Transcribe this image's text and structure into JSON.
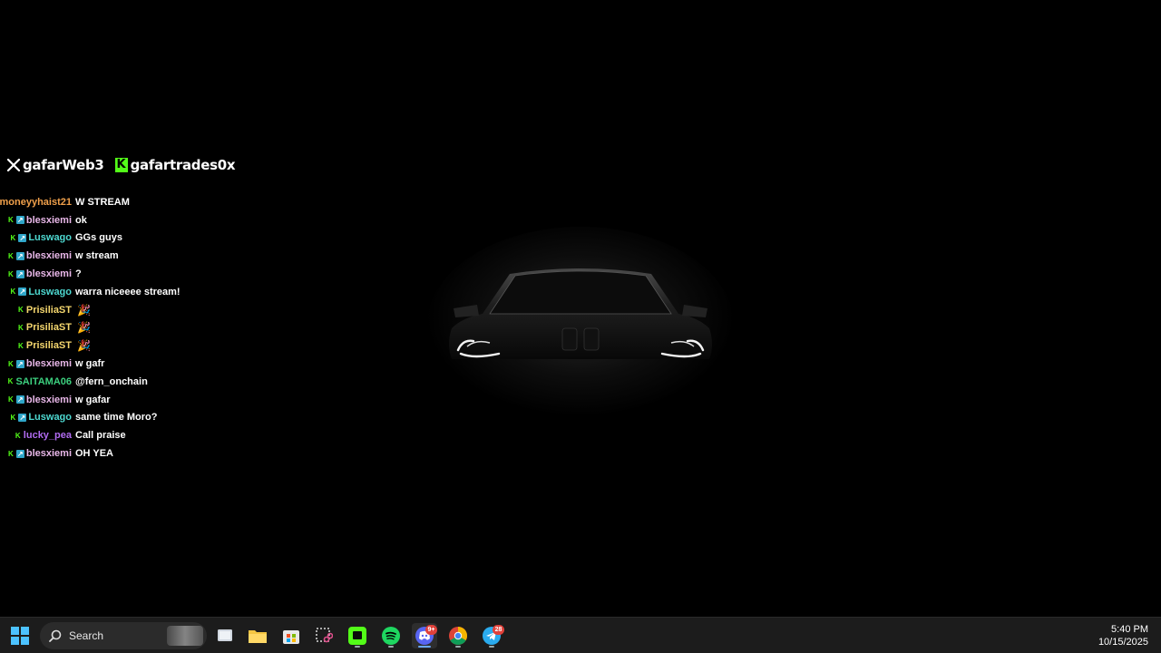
{
  "social": {
    "x_handle": "gafarWeb3",
    "kick_handle": "gafartrades0x"
  },
  "chat": [
    {
      "user": "moneyyhaist21",
      "color": "#f0a04b",
      "badges": [],
      "text": "W STREAM"
    },
    {
      "user": "blesxiemi",
      "color": "#e8b7e8",
      "badges": [
        "kick",
        "sub"
      ],
      "text": "ok"
    },
    {
      "user": "Luswago",
      "color": "#4dd8d0",
      "badges": [
        "kick",
        "sub"
      ],
      "text": "GGs guys"
    },
    {
      "user": "blesxiemi",
      "color": "#e8b7e8",
      "badges": [
        "kick",
        "sub"
      ],
      "text": "w stream"
    },
    {
      "user": "blesxiemi",
      "color": "#e8b7e8",
      "badges": [
        "kick",
        "sub"
      ],
      "text": "?"
    },
    {
      "user": "Luswago",
      "color": "#4dd8d0",
      "badges": [
        "kick",
        "sub"
      ],
      "text": "warra niceeee stream!"
    },
    {
      "user": "PrisiliaST",
      "color": "#f5d76e",
      "badges": [
        "kick"
      ],
      "text": "",
      "emote": "🎉"
    },
    {
      "user": "PrisiliaST",
      "color": "#f5d76e",
      "badges": [
        "kick"
      ],
      "text": "",
      "emote": "🎉"
    },
    {
      "user": "PrisiliaST",
      "color": "#f5d76e",
      "badges": [
        "kick"
      ],
      "text": "",
      "emote": "🎉"
    },
    {
      "user": "blesxiemi",
      "color": "#e8b7e8",
      "badges": [
        "kick",
        "sub"
      ],
      "text": "w gafr"
    },
    {
      "user": "SAITAMA06",
      "color": "#3ccf7e",
      "badges": [
        "kick"
      ],
      "text": "@fern_onchain"
    },
    {
      "user": "blesxiemi",
      "color": "#e8b7e8",
      "badges": [
        "kick",
        "sub"
      ],
      "text": "w gafar"
    },
    {
      "user": "Luswago",
      "color": "#4dd8d0",
      "badges": [
        "kick",
        "sub"
      ],
      "text": "same time Moro?"
    },
    {
      "user": "lucky_pea",
      "color": "#b06bf0",
      "badges": [
        "kick"
      ],
      "text": "Call praise"
    },
    {
      "user": "blesxiemi",
      "color": "#e8b7e8",
      "badges": [
        "kick",
        "sub"
      ],
      "text": "OH YEA"
    }
  ],
  "taskbar": {
    "search_label": "Search",
    "time": "5:40 PM",
    "date": "10/15/2025",
    "discord_badge": "9+",
    "telegram_badge": "28",
    "accent_color": "#0078d4"
  }
}
